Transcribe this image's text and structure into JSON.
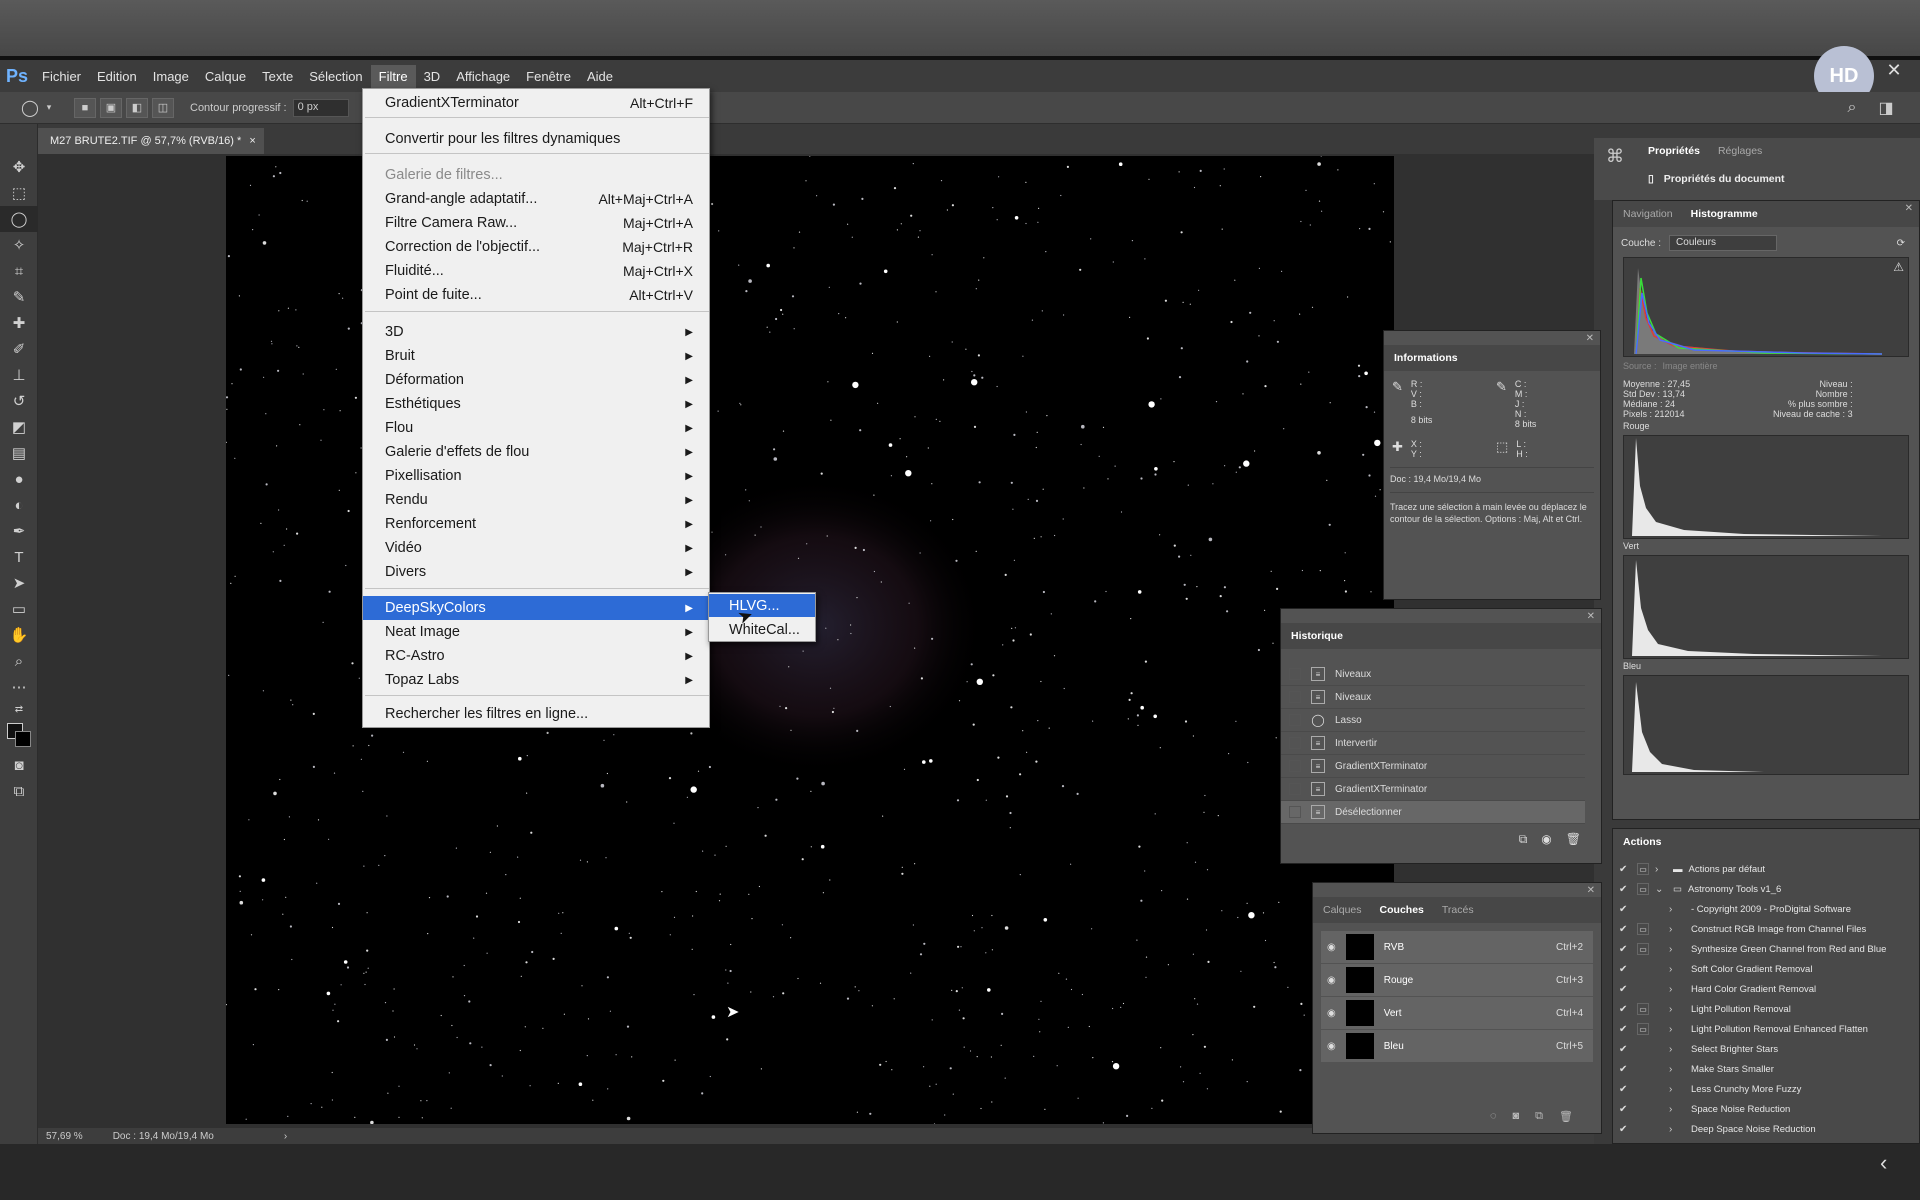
{
  "app": {
    "logo": "Ps"
  },
  "menubar": {
    "items": [
      "Fichier",
      "Edition",
      "Image",
      "Calque",
      "Texte",
      "Sélection",
      "Filtre",
      "3D",
      "Affichage",
      "Fenêtre",
      "Aide"
    ],
    "active": "Filtre"
  },
  "avatar": {
    "initials": "HD"
  },
  "window": {
    "close": "✕"
  },
  "options": {
    "feather_label": "Contour progressif :",
    "feather_value": "0 px"
  },
  "document": {
    "tab_title": "M27 BRUTE2.TIF @ 57,7% (RVB/16) *",
    "tab_close": "×"
  },
  "status": {
    "zoom": "57,69 %",
    "doc": "Doc : 19,4 Mo/19,4 Mo",
    "arrow": "›"
  },
  "filter_menu": {
    "items": [
      {
        "label": "GradientXTerminator",
        "shortcut": "Alt+Ctrl+F"
      },
      {
        "label": "Convertir pour les filtres dynamiques",
        "shortcut": ""
      },
      {
        "label": "Galerie de filtres...",
        "shortcut": "",
        "disabled": true
      },
      {
        "label": "Grand-angle adaptatif...",
        "shortcut": "Alt+Maj+Ctrl+A"
      },
      {
        "label": "Filtre Camera Raw...",
        "shortcut": "Maj+Ctrl+A"
      },
      {
        "label": "Correction de l'objectif...",
        "shortcut": "Maj+Ctrl+R"
      },
      {
        "label": "Fluidité...",
        "shortcut": "Maj+Ctrl+X"
      },
      {
        "label": "Point de fuite...",
        "shortcut": "Alt+Ctrl+V"
      },
      {
        "label": "3D"
      },
      {
        "label": "Bruit"
      },
      {
        "label": "Déformation"
      },
      {
        "label": "Esthétiques"
      },
      {
        "label": "Flou"
      },
      {
        "label": "Galerie d'effets de flou"
      },
      {
        "label": "Pixellisation"
      },
      {
        "label": "Rendu"
      },
      {
        "label": "Renforcement"
      },
      {
        "label": "Vidéo"
      },
      {
        "label": "Divers"
      },
      {
        "label": "DeepSkyColors"
      },
      {
        "label": "Neat Image"
      },
      {
        "label": "RC-Astro"
      },
      {
        "label": "Topaz Labs"
      },
      {
        "label": "Rechercher les filtres en ligne..."
      }
    ],
    "submenu_arrow": "▶"
  },
  "deepsky_submenu": {
    "items": [
      "HLVG...",
      "WhiteCal..."
    ]
  },
  "properties": {
    "tabs": [
      "Propriétés",
      "Réglages"
    ],
    "doc_props": "Propriétés du document"
  },
  "histogram": {
    "tabs": [
      "Navigation",
      "Histogramme"
    ],
    "channel_label": "Couche :",
    "channel_value": "Couleurs",
    "source_label": "Source :",
    "source_value": "Image entière",
    "stats_left": [
      [
        "Moyenne :",
        "27,45"
      ],
      [
        "Std Dev :",
        "13,74"
      ],
      [
        "Médiane :",
        "24"
      ],
      [
        "Pixels :",
        "212014"
      ]
    ],
    "stats_right": [
      "Niveau :",
      "Nombre :",
      "% plus sombre :",
      "Niveau de cache :"
    ],
    "cache_level": "3",
    "channels": [
      "Rouge",
      "Vert",
      "Bleu"
    ]
  },
  "info_panel": {
    "title": "Informations",
    "rvb": [
      "R :",
      "V :",
      "B :"
    ],
    "cmjn": [
      "C :",
      "M :",
      "J :",
      "N :"
    ],
    "bits": "8 bits",
    "xy": [
      "X :",
      "Y :"
    ],
    "lh": [
      "L :",
      "H :"
    ],
    "doc": "Doc : 19,4 Mo/19,4 Mo",
    "hint": "Tracez une sélection à main levée ou déplacez le contour de la sélection. Options : Maj, Alt et Ctrl."
  },
  "history_panel": {
    "title": "Historique",
    "items": [
      "Niveaux",
      "Niveaux",
      "Lasso",
      "Intervertir",
      "GradientXTerminator",
      "GradientXTerminator",
      "Désélectionner"
    ]
  },
  "channels_panel": {
    "tabs": [
      "Calques",
      "Couches",
      "Tracés"
    ],
    "rows": [
      {
        "name": "RVB",
        "shortcut": "Ctrl+2"
      },
      {
        "name": "Rouge",
        "shortcut": "Ctrl+3"
      },
      {
        "name": "Vert",
        "shortcut": "Ctrl+4"
      },
      {
        "name": "Bleu",
        "shortcut": "Ctrl+5"
      }
    ]
  },
  "actions_panel": {
    "title": "Actions",
    "items": [
      {
        "name": "Actions par défaut",
        "level": 0,
        "folder": true
      },
      {
        "name": "Astronomy Tools v1_6",
        "level": 0,
        "folder": true,
        "open": true
      },
      {
        "name": "- Copyright 2009 - ProDigital Software",
        "level": 1
      },
      {
        "name": "Construct RGB Image from Channel Files",
        "level": 1,
        "dialog": true
      },
      {
        "name": "Synthesize Green Channel from Red and Blue",
        "level": 1,
        "dialog": true
      },
      {
        "name": "Soft Color Gradient Removal",
        "level": 1
      },
      {
        "name": "Hard Color Gradient Removal",
        "level": 1
      },
      {
        "name": "Light Pollution Removal",
        "level": 1,
        "dialog": true
      },
      {
        "name": "Light Pollution Removal Enhanced Flatten",
        "level": 1,
        "dialog": true
      },
      {
        "name": "Select Brighter Stars",
        "level": 1
      },
      {
        "name": "Make Stars Smaller",
        "level": 1
      },
      {
        "name": "Less Crunchy More Fuzzy",
        "level": 1
      },
      {
        "name": "Space Noise Reduction",
        "level": 1
      },
      {
        "name": "Deep Space Noise Reduction",
        "level": 1
      }
    ]
  },
  "colors": {
    "highlight": "#2d6bd6",
    "ps_blue": "#6fb3ff"
  }
}
